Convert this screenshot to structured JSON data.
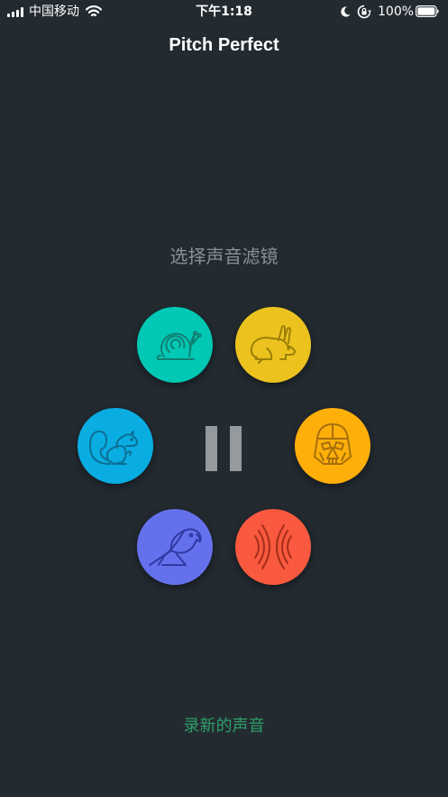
{
  "status_bar": {
    "carrier": "中国移动",
    "time": "下午1:18",
    "battery": "100%",
    "icons": [
      "signal-icon",
      "wifi-icon",
      "moon-icon",
      "rotation-lock-icon",
      "battery-icon"
    ]
  },
  "nav": {
    "title": "Pitch Perfect"
  },
  "main": {
    "prompt": "选择声音滤镜",
    "effects": [
      {
        "icon": "snail-icon",
        "color": "#00c8b4"
      },
      {
        "icon": "rabbit-icon",
        "color": "#ecc31e"
      },
      {
        "icon": "squirrel-icon",
        "color": "#09ade2"
      },
      {
        "icon": "darth-vader-icon",
        "color": "#ffaf0a"
      },
      {
        "icon": "parrot-icon",
        "color": "#6571ec"
      },
      {
        "icon": "reverb-icon",
        "color": "#f9593e"
      }
    ],
    "pause_icon": "pause-icon",
    "pause_color": "#959a9e"
  },
  "footer": {
    "record_new": "录新的声音",
    "link_color": "#2e9f68"
  },
  "colors": {
    "background": "#232b31",
    "prompt_text": "#8a9096"
  }
}
